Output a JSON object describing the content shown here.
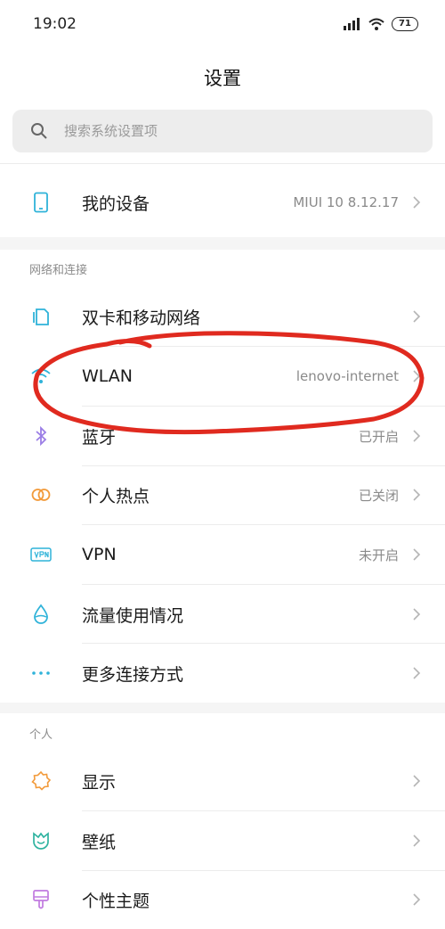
{
  "status_bar": {
    "time": "19:02",
    "battery": "71"
  },
  "header": {
    "title": "设置"
  },
  "search": {
    "placeholder": "搜索系统设置项"
  },
  "device": {
    "label": "我的设备",
    "value": "MIUI 10 8.12.17"
  },
  "sections": {
    "network": {
      "title": "网络和连接",
      "items": [
        {
          "label": "双卡和移动网络",
          "value": ""
        },
        {
          "label": "WLAN",
          "value": "lenovo-internet"
        },
        {
          "label": "蓝牙",
          "value": "已开启"
        },
        {
          "label": "个人热点",
          "value": "已关闭"
        },
        {
          "label": "VPN",
          "value": "未开启"
        },
        {
          "label": "流量使用情况",
          "value": ""
        },
        {
          "label": "更多连接方式",
          "value": ""
        }
      ]
    },
    "personal": {
      "title": "个人",
      "items": [
        {
          "label": "显示",
          "value": ""
        },
        {
          "label": "壁纸",
          "value": ""
        },
        {
          "label": "个性主题",
          "value": ""
        }
      ]
    }
  },
  "icons": {
    "device": "phone-icon",
    "sim": "sim-card-icon",
    "wlan": "wifi-icon",
    "bluetooth": "bluetooth-icon",
    "hotspot": "hotspot-icon",
    "vpn": "vpn-icon",
    "data_usage": "water-drop-icon",
    "more": "more-dots-icon",
    "display": "sun-icon",
    "wallpaper": "tulip-icon",
    "theme": "brush-icon"
  },
  "colors": {
    "accent": "#2fb3d9",
    "annotation": "#e02a1f"
  }
}
